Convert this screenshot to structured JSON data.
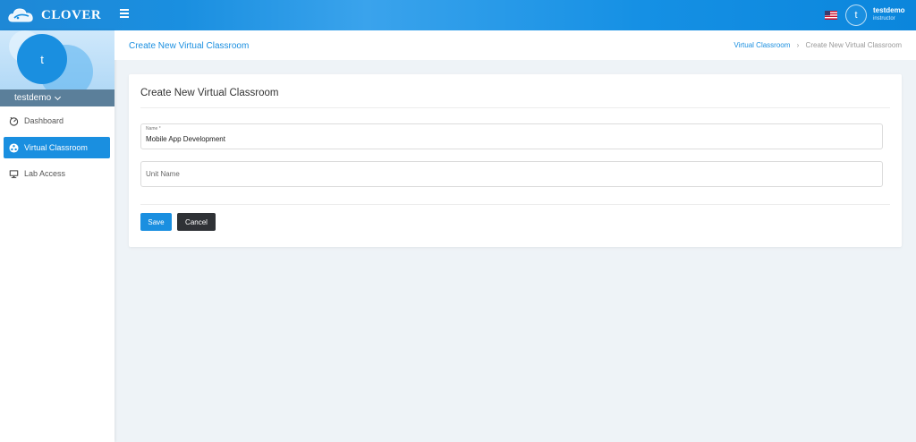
{
  "app": {
    "brand": "CLOVER"
  },
  "topbar": {
    "user_name": "testdemo",
    "user_role": "instructor",
    "avatar_initial": "t"
  },
  "sidebar": {
    "avatar_initial": "t",
    "username": "testdemo",
    "items": [
      {
        "label": "Dashboard",
        "icon": "dashboard-icon",
        "active": false
      },
      {
        "label": "Virtual Classroom",
        "icon": "classroom-icon",
        "active": true
      },
      {
        "label": "Lab Access",
        "icon": "monitor-icon",
        "active": false
      }
    ]
  },
  "header": {
    "title": "Create New Virtual Classroom",
    "breadcrumb": [
      "Virtual Classroom",
      "Create New Virtual Classroom"
    ]
  },
  "form": {
    "title": "Create New Virtual Classroom",
    "name_label": "Name *",
    "name_value": "Mobile App Development",
    "unit_placeholder": "Unit Name",
    "save_label": "Save",
    "cancel_label": "Cancel"
  },
  "colors": {
    "accent": "#1a8fe0",
    "dark_button": "#2f3236",
    "page_bg": "#eef3f7"
  }
}
